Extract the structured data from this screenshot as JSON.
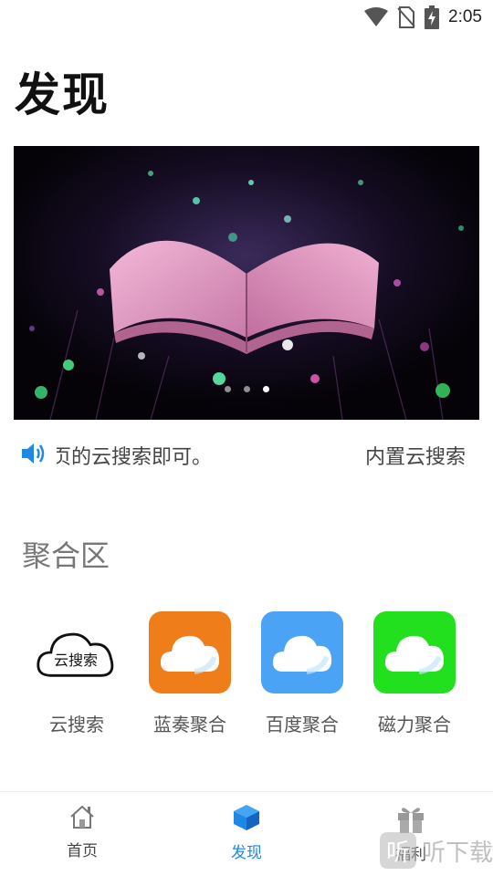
{
  "status_bar": {
    "time": "2:05",
    "icons": [
      "wifi-icon",
      "no-sim-icon",
      "battery-charging-icon"
    ]
  },
  "page": {
    "title": "发现"
  },
  "banner": {
    "image": "open-book-with-glowing-particles",
    "slide_count": 3,
    "active_slide": 3
  },
  "announcement": {
    "icon": "speaker-icon",
    "text_part_1": "页的云搜索即可。",
    "text_part_2": "内置云搜索"
  },
  "aggregation": {
    "title": "聚合区",
    "items": [
      {
        "label": "云搜索",
        "icon": "cloud-search-icon",
        "icon_text": "云搜索",
        "color": "#ffffff"
      },
      {
        "label": "蓝奏聚合",
        "icon": "cloud-icon",
        "color": "#ee7d1a"
      },
      {
        "label": "百度聚合",
        "icon": "cloud-icon",
        "color": "#4aa3f5"
      },
      {
        "label": "磁力聚合",
        "icon": "cloud-icon",
        "color": "#22e01e"
      }
    ]
  },
  "bottom_nav": {
    "items": [
      {
        "label": "首页",
        "icon": "house-icon",
        "active": false
      },
      {
        "label": "发现",
        "icon": "cube-icon",
        "active": true
      },
      {
        "label": "福利",
        "icon": "gift-icon",
        "active": false
      }
    ]
  },
  "watermark": {
    "badge": "听",
    "text": "听下载"
  },
  "colors": {
    "accent": "#1e88e5",
    "text_muted": "#777777"
  }
}
